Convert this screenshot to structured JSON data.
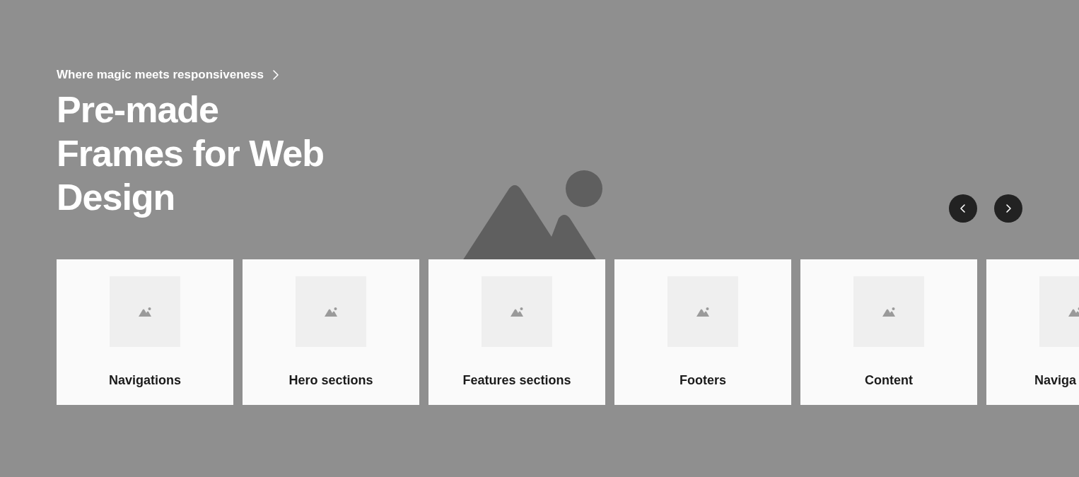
{
  "hero": {
    "tagline": "Where magic meets responsiveness",
    "title_lines": [
      "Pre-made",
      "Frames for Web",
      "Design"
    ]
  },
  "carousel_controls": [
    {
      "kind": "previous"
    },
    {
      "kind": "next"
    }
  ],
  "cards": [
    {
      "label": "Navigations"
    },
    {
      "label": "Hero sections"
    },
    {
      "label": "Features sections"
    },
    {
      "label": "Footers"
    },
    {
      "label": "Content"
    },
    {
      "label": "Naviga",
      "cut_off": true
    }
  ]
}
